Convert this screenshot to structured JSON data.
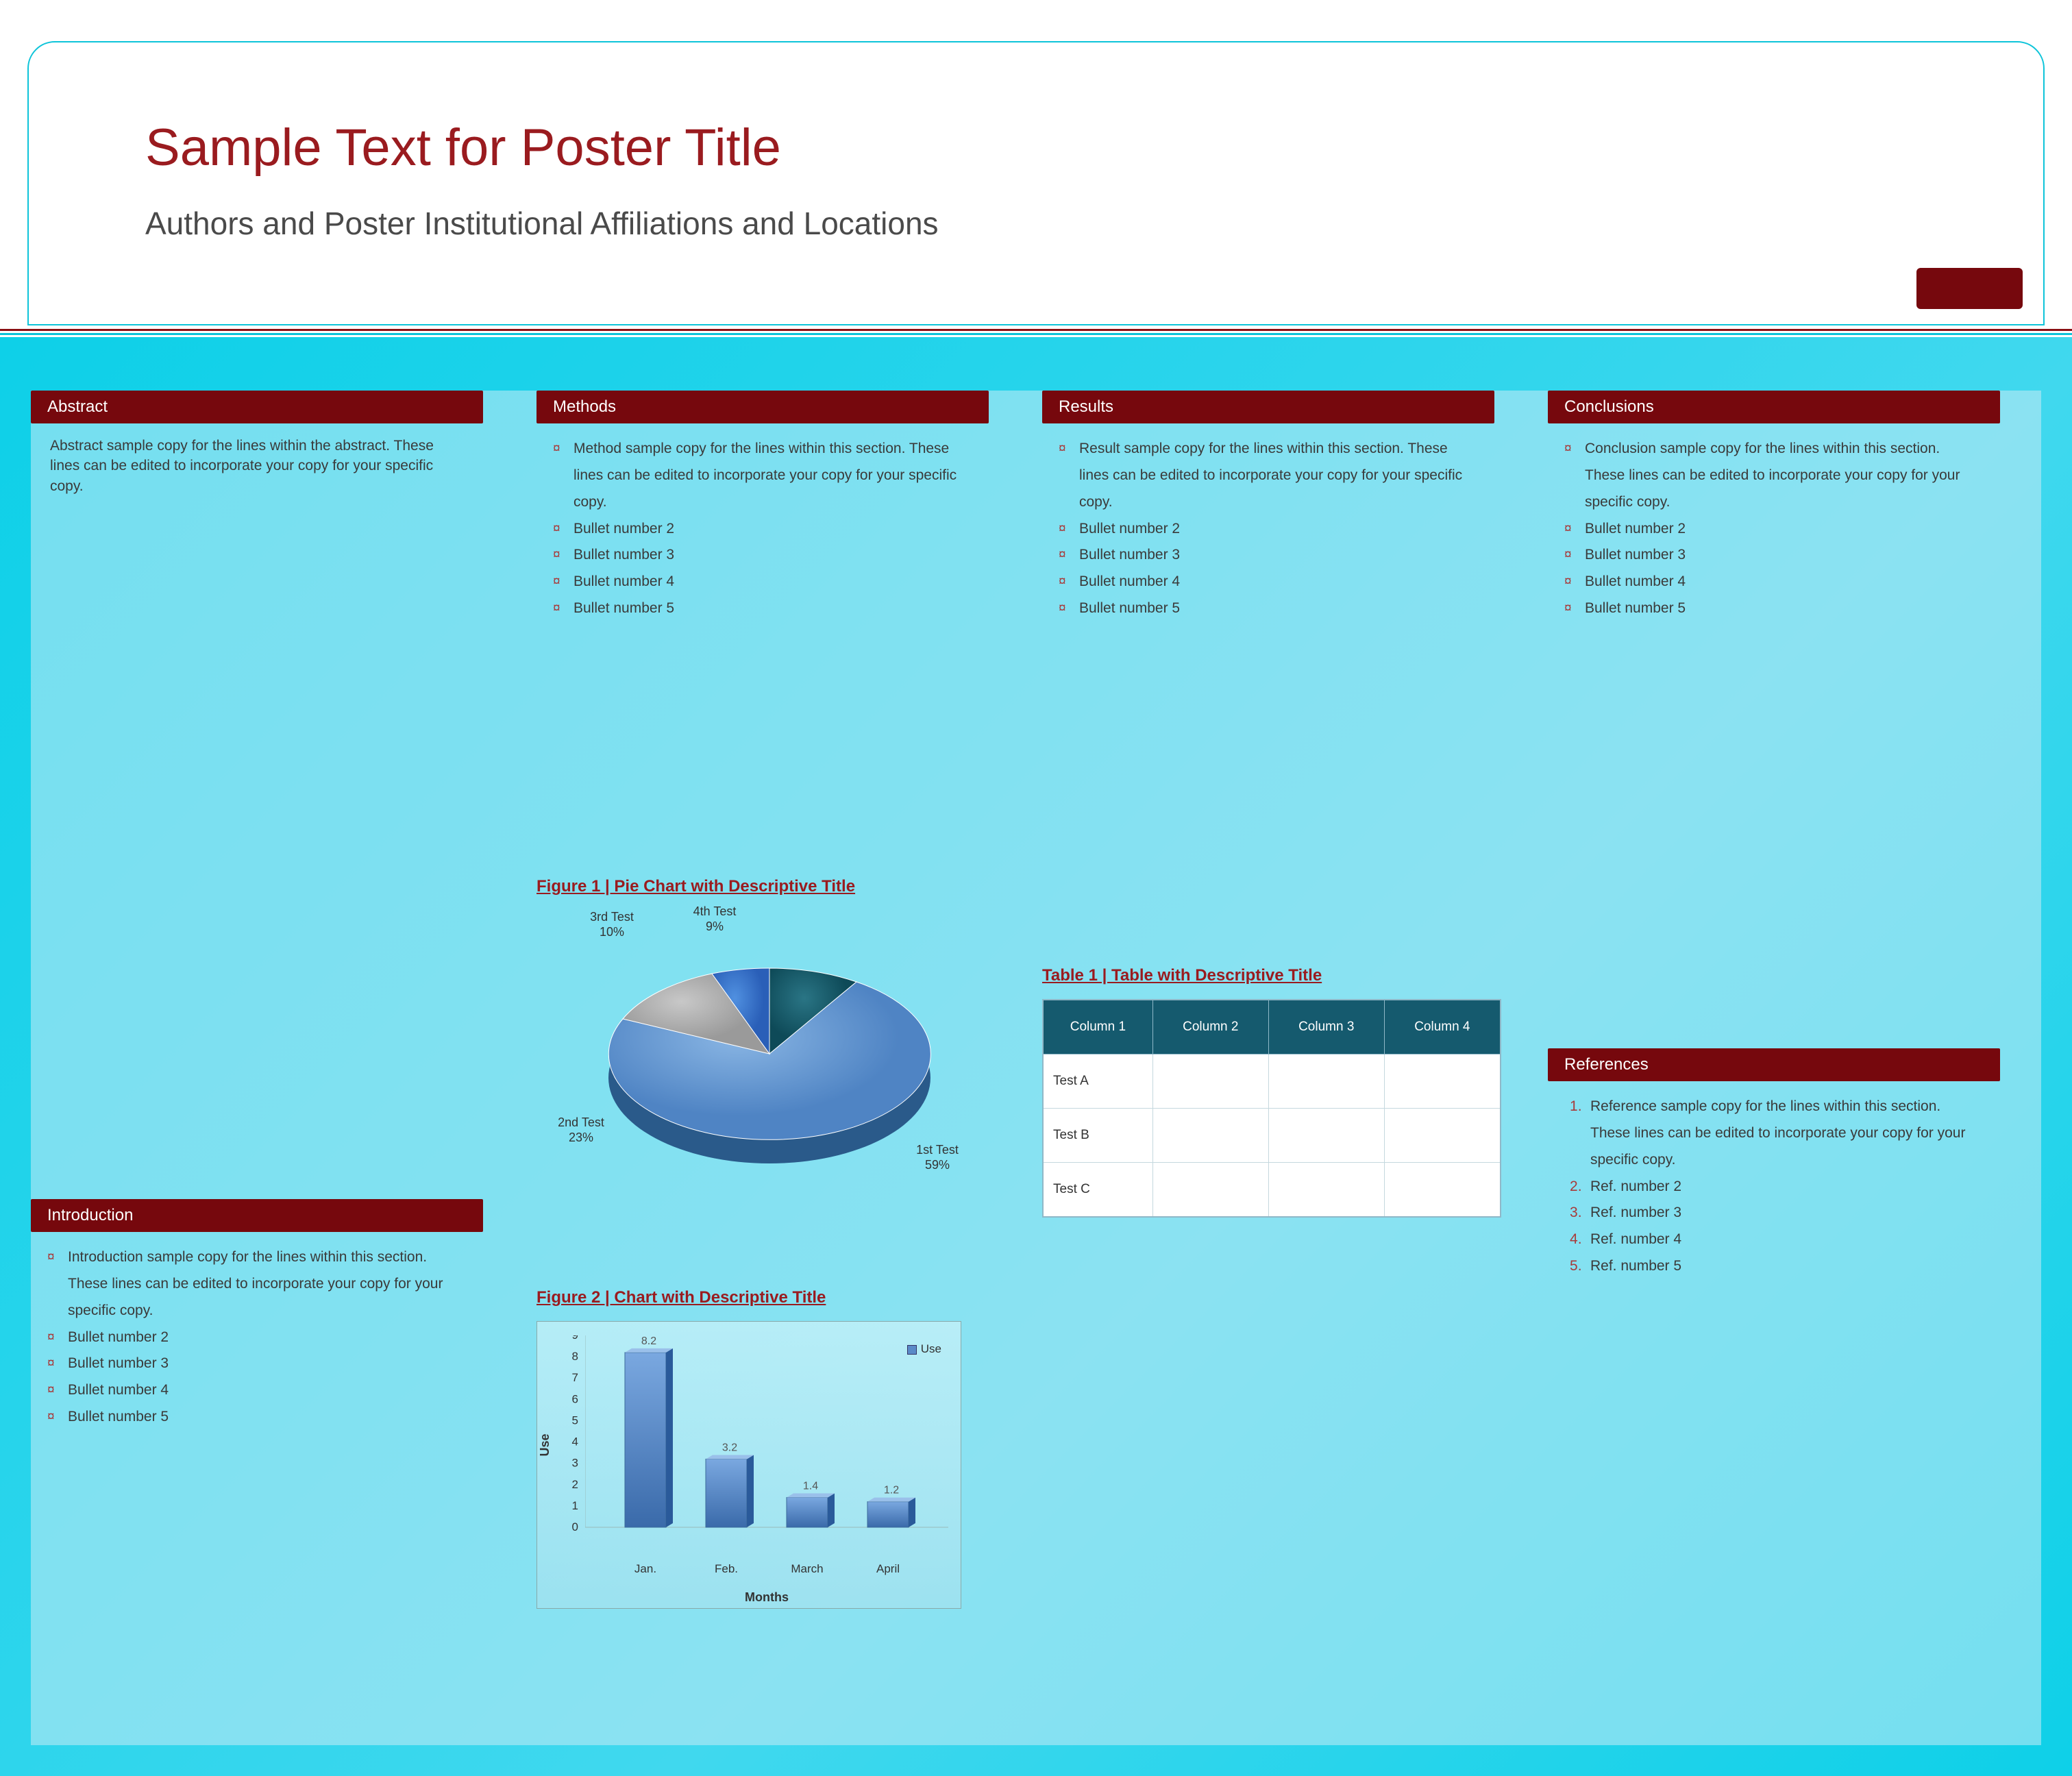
{
  "header": {
    "title": "Sample Text for Poster Title",
    "subtitle": "Authors and Poster Institutional Affiliations and Locations"
  },
  "abstract": {
    "heading": "Abstract",
    "body": "Abstract sample copy for the lines within the abstract. These lines can be edited to incorporate your copy for your specific copy."
  },
  "introduction": {
    "heading": "Introduction",
    "items": [
      "Introduction sample copy for the lines within this section. These lines can be edited to incorporate your copy for your specific copy.",
      "Bullet number 2",
      "Bullet number 3",
      "Bullet number 4",
      "Bullet number 5"
    ]
  },
  "methods": {
    "heading": "Methods",
    "items": [
      "Method sample copy for the lines within this section. These lines can be edited to incorporate your copy for your specific copy.",
      "Bullet number 2",
      "Bullet number 3",
      "Bullet number 4",
      "Bullet number 5"
    ]
  },
  "results": {
    "heading": "Results",
    "items": [
      "Result sample copy for the lines within this section. These lines can be edited to incorporate your copy for your specific copy.",
      "Bullet number 2",
      "Bullet number 3",
      "Bullet number 4",
      "Bullet number 5"
    ]
  },
  "conclusions": {
    "heading": "Conclusions",
    "items": [
      "Conclusion sample copy for the lines within this section. These lines can be edited to incorporate your copy for your specific copy.",
      "Bullet number 2",
      "Bullet number 3",
      "Bullet number 4",
      "Bullet number 5"
    ]
  },
  "references": {
    "heading": "References",
    "items": [
      "Reference sample copy for the lines within this section. These lines can be edited to incorporate your copy for your specific copy.",
      "Ref. number 2",
      "Ref. number 3",
      "Ref. number 4",
      "Ref. number 5"
    ]
  },
  "figure1": {
    "title": "Figure 1 | Pie Chart with Descriptive Title",
    "labels": {
      "slice1": "1st Test\n59%",
      "slice2": "2nd Test\n23%",
      "slice3": "3rd Test\n10%",
      "slice4": "4th Test\n9%"
    }
  },
  "figure2": {
    "title": "Figure 2 | Chart with Descriptive Title",
    "xlabel": "Months",
    "ylabel": "Use",
    "legend": "Use"
  },
  "table1": {
    "title": "Table 1 | Table with Descriptive Title",
    "headers": [
      "Column 1",
      "Column 2",
      "Column 3",
      "Column 4"
    ],
    "rows": [
      [
        "Test A",
        "",
        "",
        ""
      ],
      [
        "Test B",
        "",
        "",
        ""
      ],
      [
        "Test C",
        "",
        "",
        ""
      ]
    ]
  },
  "chart_data": [
    {
      "type": "pie",
      "title": "Figure 1 | Pie Chart with Descriptive Title",
      "series": [
        {
          "name": "1st Test",
          "value": 59
        },
        {
          "name": "2nd Test",
          "value": 23
        },
        {
          "name": "3rd Test",
          "value": 10
        },
        {
          "name": "4th Test",
          "value": 9
        }
      ]
    },
    {
      "type": "bar",
      "title": "Figure 2 | Chart with Descriptive Title",
      "xlabel": "Months",
      "ylabel": "Use",
      "categories": [
        "Jan.",
        "Feb.",
        "March",
        "April"
      ],
      "series": [
        {
          "name": "Use",
          "values": [
            8.2,
            3.2,
            1.4,
            1.2
          ]
        }
      ],
      "ylim": [
        0,
        9
      ]
    },
    {
      "type": "table",
      "title": "Table 1 | Table with Descriptive Title",
      "headers": [
        "Column 1",
        "Column 2",
        "Column 3",
        "Column 4"
      ],
      "rows": [
        [
          "Test A",
          "",
          "",
          ""
        ],
        [
          "Test B",
          "",
          "",
          ""
        ],
        [
          "Test C",
          "",
          "",
          ""
        ]
      ]
    }
  ]
}
